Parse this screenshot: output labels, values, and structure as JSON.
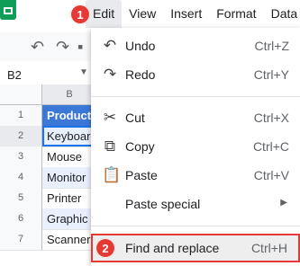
{
  "menubar": {
    "items": [
      "Edit",
      "View",
      "Insert",
      "Format",
      "Data"
    ],
    "active_index": 0
  },
  "namebox": {
    "value": "B2"
  },
  "column_header": "B",
  "rows": [
    {
      "num": "1",
      "value": "Product"
    },
    {
      "num": "2",
      "value": "Keyboard"
    },
    {
      "num": "3",
      "value": "Mouse"
    },
    {
      "num": "4",
      "value": "Monitor"
    },
    {
      "num": "5",
      "value": "Printer"
    },
    {
      "num": "6",
      "value": "Graphic"
    },
    {
      "num": "7",
      "value": "Scanner"
    }
  ],
  "edit_menu": {
    "undo": {
      "label": "Undo",
      "shortcut": "Ctrl+Z"
    },
    "redo": {
      "label": "Redo",
      "shortcut": "Ctrl+Y"
    },
    "cut": {
      "label": "Cut",
      "shortcut": "Ctrl+X"
    },
    "copy": {
      "label": "Copy",
      "shortcut": "Ctrl+C"
    },
    "paste": {
      "label": "Paste",
      "shortcut": "Ctrl+V"
    },
    "paste_special": {
      "label": "Paste special"
    },
    "find_replace": {
      "label": "Find and replace",
      "shortcut": "Ctrl+H"
    }
  },
  "badges": [
    "1",
    "2"
  ],
  "colors": {
    "header_fill": "#3c78d8",
    "highlight_border": "#e53935",
    "badge": "#e53935",
    "selection": "#1a73e8"
  }
}
